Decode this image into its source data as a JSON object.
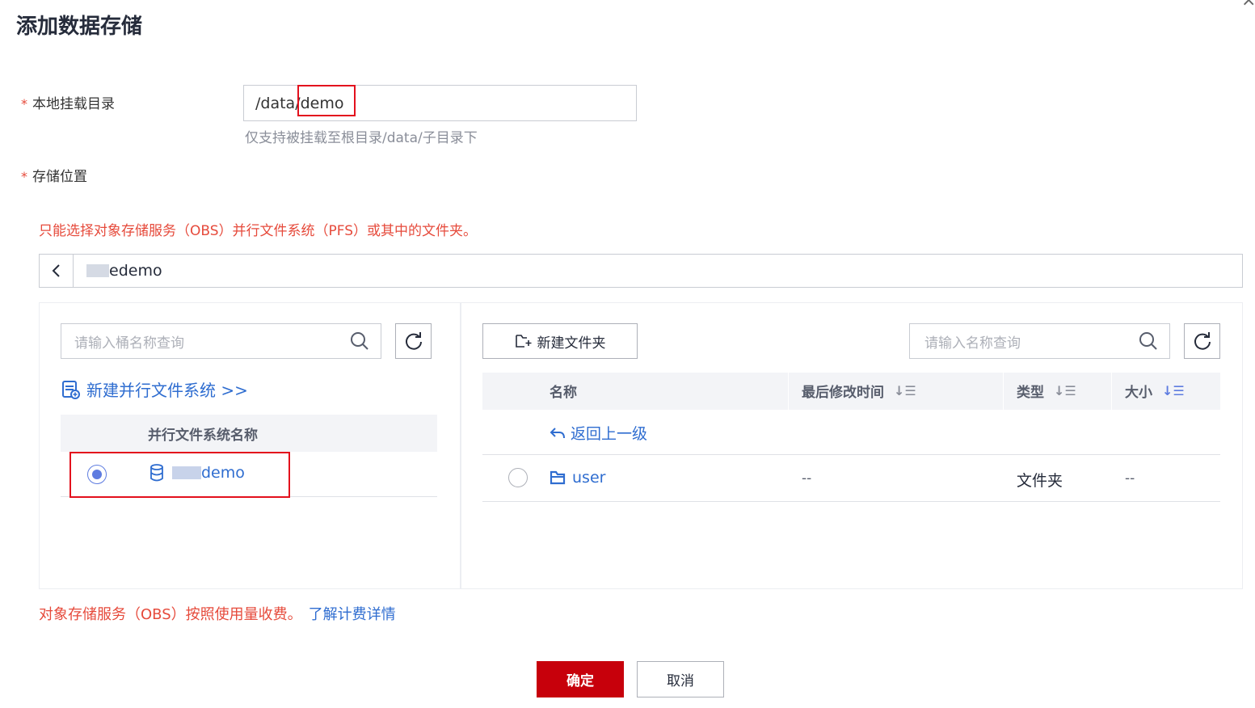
{
  "dialog": {
    "title": "添加数据存储",
    "close_glyph": "×"
  },
  "mount": {
    "label": "本地挂载目录",
    "prefix": "/data/",
    "value": "demo",
    "hint": "仅支持被挂载至根目录/data/子目录下"
  },
  "storage": {
    "label": "存储位置",
    "warning": "只能选择对象存储服务（OBS）并行文件系统（PFS）或其中的文件夹。",
    "path_suffix": "edemo"
  },
  "left_panel": {
    "search_placeholder": "请输入桶名称查询",
    "create_link": "新建并行文件系统 >>",
    "column_header": "并行文件系统名称",
    "rows": [
      {
        "name_suffix": "demo",
        "selected": true
      }
    ]
  },
  "right_panel": {
    "new_folder_label": "新建文件夹",
    "search_placeholder": "请输入名称查询",
    "columns": {
      "name": "名称",
      "modified": "最后修改时间",
      "type": "类型",
      "size": "大小"
    },
    "back_link": "返回上一级",
    "rows": [
      {
        "name": "user",
        "modified": "--",
        "type": "文件夹",
        "size": "--",
        "selected": false
      }
    ]
  },
  "billing": {
    "note": "对象存储服务（OBS）按照使用量收费。",
    "link": "了解计费详情"
  },
  "footer": {
    "confirm": "确定",
    "cancel": "取消"
  },
  "colors": {
    "primary": "#c7000b",
    "link": "#2f6dd0",
    "warning": "#e64a3b",
    "highlight_frame": "#e3101d",
    "radio": "#5e7ce0"
  },
  "icons": [
    "close-icon",
    "required-star-icon",
    "chevron-left-icon",
    "search-icon",
    "refresh-icon",
    "pfs-create-icon",
    "database-icon",
    "new-folder-icon",
    "sort-icon",
    "back-arrow-icon",
    "folder-icon"
  ]
}
